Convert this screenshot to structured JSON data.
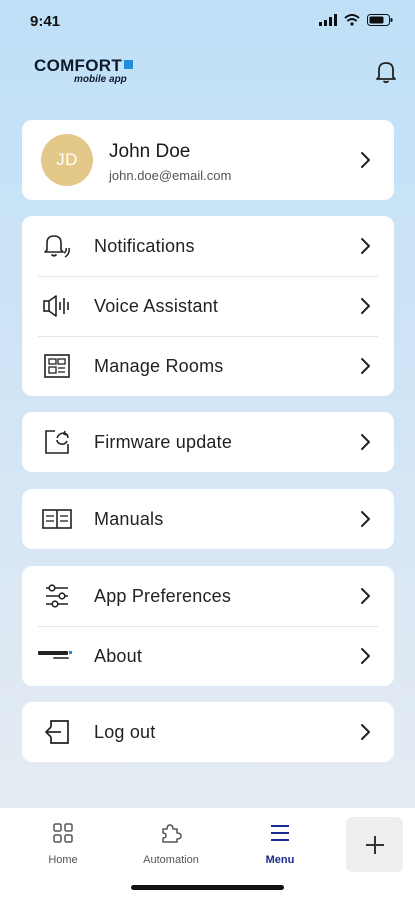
{
  "status_bar": {
    "time": "9:41"
  },
  "header": {
    "logo_main": "COMFORT",
    "logo_sub": "mobile app"
  },
  "profile": {
    "initials": "JD",
    "name": "John Doe",
    "email": "john.doe@email.com"
  },
  "menu": {
    "notifications": "Notifications",
    "voice_assistant": "Voice Assistant",
    "manage_rooms": "Manage Rooms",
    "firmware_update": "Firmware update",
    "manuals": "Manuals",
    "app_preferences": "App Preferences",
    "about": "About",
    "log_out": "Log out"
  },
  "tab_bar": {
    "home": "Home",
    "automation": "Automation",
    "menu": "Menu",
    "active": "Menu"
  },
  "colors": {
    "accent": "#1b2a8e",
    "avatar": "#e3c889",
    "logo_plus": "#1f8fd9"
  }
}
